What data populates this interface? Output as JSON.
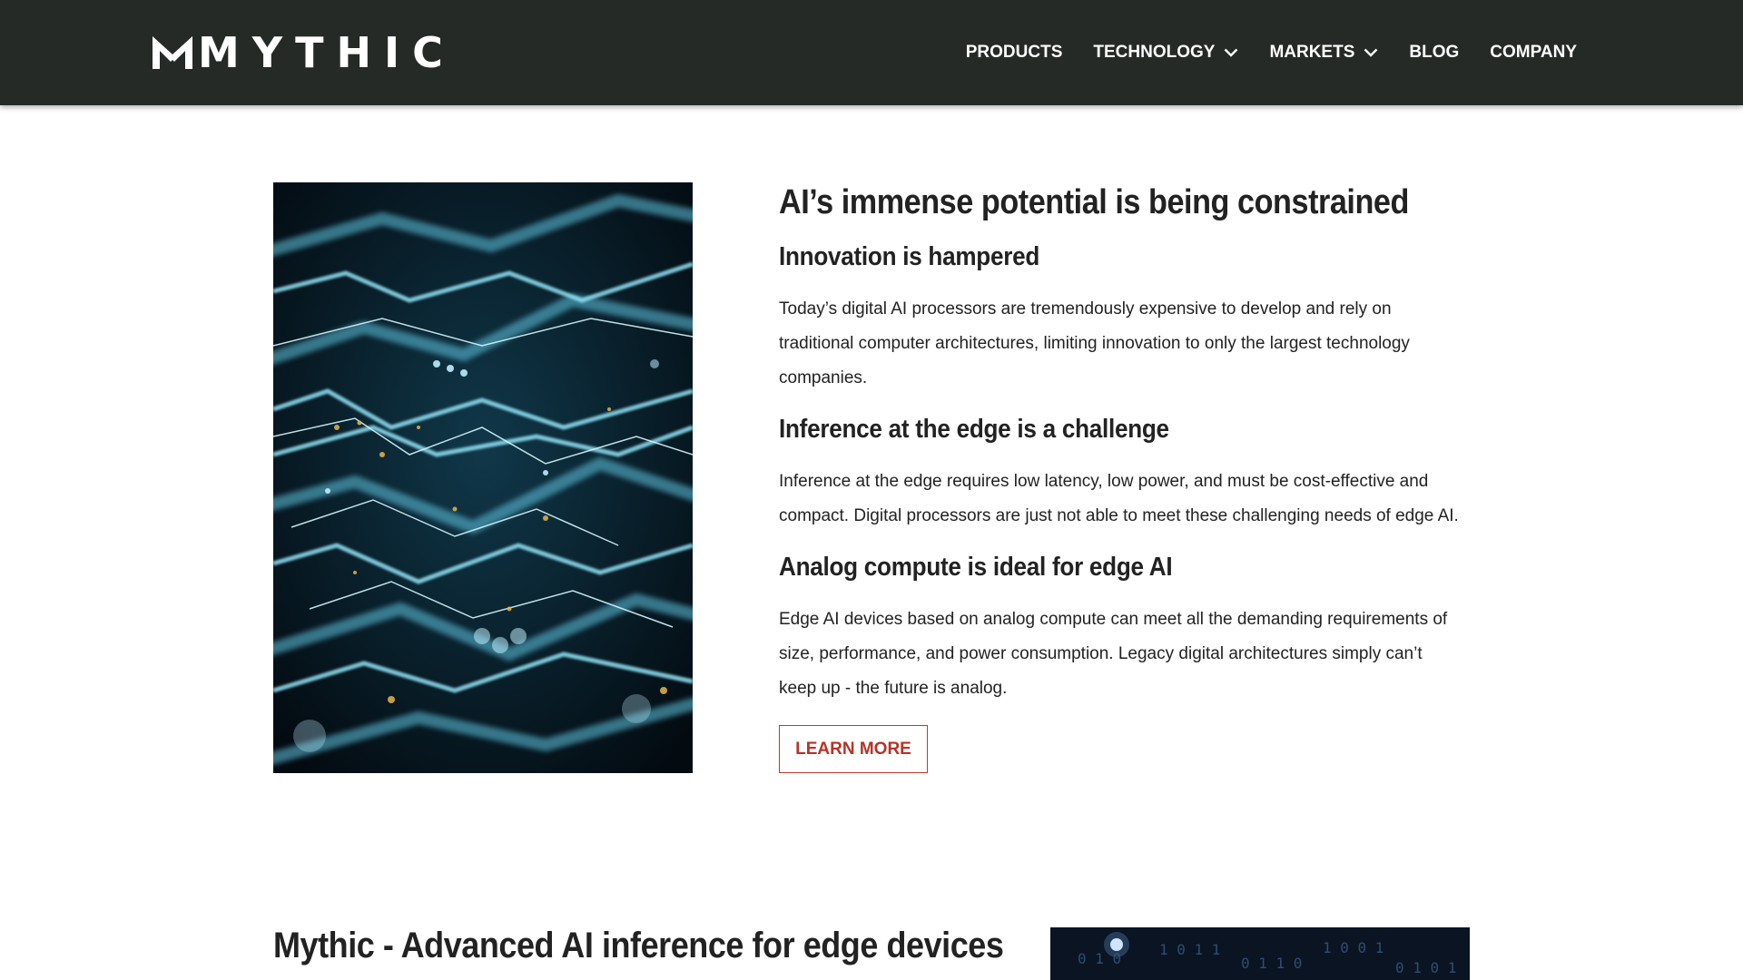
{
  "header": {
    "logo_text": "MYTHIC",
    "nav": [
      {
        "label": "PRODUCTS",
        "has_dropdown": false
      },
      {
        "label": "TECHNOLOGY",
        "has_dropdown": true
      },
      {
        "label": "MARKETS",
        "has_dropdown": true
      },
      {
        "label": "BLOG",
        "has_dropdown": false
      },
      {
        "label": "COMPANY",
        "has_dropdown": false
      }
    ],
    "background_color": "#262a27"
  },
  "section1": {
    "title": "AI’s immense potential is being constrained",
    "blocks": [
      {
        "heading": "Innovation is hampered",
        "lines": [
          "Today’s digital AI processors are tremendously expensive to develop and rely on",
          "traditional computer architectures, limiting innovation to only the largest technology",
          "companies."
        ]
      },
      {
        "heading": "Inference at the edge is a challenge",
        "lines": [
          "Inference at the edge requires low latency, low power, and must be cost-effective and",
          "compact. Digital processors are just not able to meet these challenging needs of edge AI."
        ]
      },
      {
        "heading": "Analog compute is ideal for edge AI",
        "lines": [
          "Edge AI devices based on analog compute can meet all the demanding requirements of",
          "size, performance, and power consumption. Legacy digital architectures simply can’t",
          "keep up - the future is analog."
        ]
      }
    ],
    "button_label": "LEARN MORE",
    "accent_color": "#c0392b",
    "image_icon": "circuit-board-image"
  },
  "section2": {
    "title": "Mythic - Advanced AI inference for edge devices",
    "image_icon": "binary-data-image"
  }
}
